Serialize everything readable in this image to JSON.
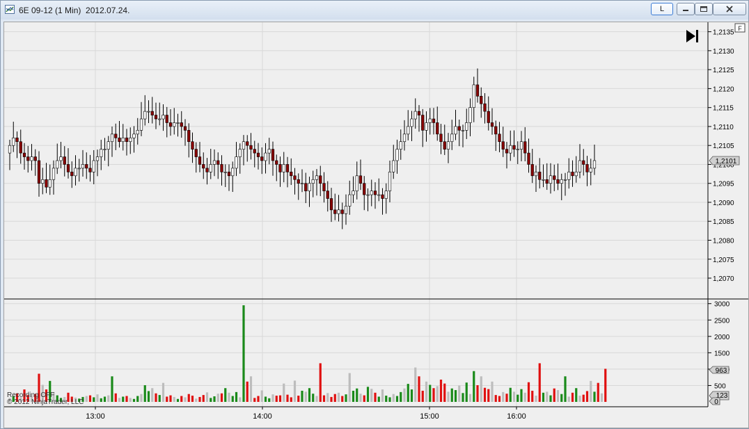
{
  "window": {
    "title": "6E 09-12 (1 Min)  2012.07.24.",
    "btn_l": "L",
    "btn_min": "",
    "btn_max": "",
    "btn_close": "",
    "corner_label": "F",
    "colors": {
      "bg": "#efefef",
      "grid": "#d8d8d8",
      "up": "#ffffff",
      "down": "#8b0000",
      "vol_up": "#1a8a1a",
      "vol_down": "#e01010",
      "vol_flat": "#bdbdbd"
    }
  },
  "status": {
    "recording": "Recording OFF",
    "copyright": "© 2012 NinjaTrader, LLC"
  },
  "chart_data": [
    {
      "type": "candlestick",
      "title": "6E 09-12 (1 Min)",
      "x_tick_labels": [
        "13:00",
        "14:00",
        "15:00",
        "16:00"
      ],
      "y_tick_labels": [
        "1,2135",
        "1,2130",
        "1,2125",
        "1,2120",
        "1,2115",
        "1,2110",
        "1,2105",
        "1,2100",
        "1,2095",
        "1,2090",
        "1,2085",
        "1,2080",
        "1,2075",
        "1,2070"
      ],
      "ylim": [
        1.20645,
        1.21375
      ],
      "last_price_label": "1,2101",
      "grid": true,
      "closes": [
        1.2105,
        1.2107,
        1.2106,
        1.2103,
        1.2102,
        1.2101,
        1.2102,
        1.2101,
        1.2095,
        1.2096,
        1.2094,
        1.2096,
        1.2099,
        1.2101,
        1.2102,
        1.21,
        1.2098,
        1.2097,
        1.2099,
        1.2099,
        1.21,
        1.2099,
        1.2098,
        1.2101,
        1.2102,
        1.2104,
        1.2104,
        1.2106,
        1.2108,
        1.2107,
        1.2106,
        1.2107,
        1.2106,
        1.2107,
        1.2108,
        1.2109,
        1.2112,
        1.2114,
        1.2114,
        1.2113,
        1.2112,
        1.2112,
        1.2113,
        1.2111,
        1.211,
        1.2111,
        1.2111,
        1.211,
        1.2109,
        1.2106,
        1.2104,
        1.2102,
        1.21,
        1.2099,
        1.2098,
        1.21,
        1.2101,
        1.21,
        1.2098,
        1.2098,
        1.2097,
        1.2099,
        1.2102,
        1.2104,
        1.2106,
        1.2105,
        1.2104,
        1.2103,
        1.2102,
        1.2101,
        1.2103,
        1.2104,
        1.2101,
        1.21,
        1.2098,
        1.21,
        1.2098,
        1.2097,
        1.2096,
        1.2095,
        1.2095,
        1.2093,
        1.2095,
        1.2096,
        1.2097,
        1.2095,
        1.2093,
        1.2091,
        1.2088,
        1.2087,
        1.2088,
        1.2087,
        1.2089,
        1.2092,
        1.2093,
        1.2097,
        1.2095,
        1.2092,
        1.2092,
        1.2093,
        1.2092,
        1.2092,
        1.2091,
        1.2093,
        1.2098,
        1.2101,
        1.2104,
        1.2106,
        1.2108,
        1.211,
        1.2112,
        1.2114,
        1.2113,
        1.2109,
        1.2111,
        1.2112,
        1.2111,
        1.2108,
        1.2106,
        1.2104,
        1.2106,
        1.2108,
        1.211,
        1.2109,
        1.2109,
        1.2111,
        1.2115,
        1.2121,
        1.2118,
        1.2116,
        1.2114,
        1.2111,
        1.211,
        1.2108,
        1.2106,
        1.2104,
        1.2103,
        1.2105,
        1.2104,
        1.2104,
        1.2106,
        1.2103,
        1.21,
        1.2097,
        1.2098,
        1.2096,
        1.2096,
        1.2095,
        1.2097,
        1.2096,
        1.2095,
        1.2096,
        1.2096,
        1.2098,
        1.2097,
        1.2098,
        1.2101,
        1.21,
        1.2098,
        1.2099,
        1.2101
      ]
    },
    {
      "type": "bar",
      "title": "Volume",
      "y_tick_labels": [
        "3000",
        "2500",
        "2000",
        "1500",
        "1000",
        "500"
      ],
      "ylim": [
        0,
        3100
      ],
      "last_volume_label": "963",
      "last_down_label": "123",
      "zero_label": "0",
      "volumes": [
        120,
        180,
        260,
        140,
        380,
        210,
        160,
        240,
        860,
        520,
        380,
        640,
        300,
        200,
        120,
        150,
        280,
        160,
        130,
        100,
        150,
        180,
        200,
        140,
        230,
        110,
        160,
        200,
        780,
        260,
        120,
        160,
        180,
        120,
        90,
        180,
        240,
        510,
        330,
        420,
        260,
        210,
        580,
        160,
        200,
        150,
        90,
        180,
        140,
        240,
        190,
        100,
        150,
        210,
        290,
        120,
        170,
        250,
        260,
        420,
        280,
        180,
        300,
        140,
        2950,
        620,
        780,
        120,
        180,
        350,
        160,
        110,
        230,
        190,
        200,
        560,
        220,
        140,
        650,
        190,
        340,
        310,
        420,
        250,
        180,
        1180,
        200,
        270,
        150,
        240,
        280,
        180,
        230,
        880,
        340,
        410,
        250,
        200,
        460,
        400,
        280,
        160,
        380,
        190,
        140,
        240,
        180,
        300,
        410,
        550,
        380,
        1050,
        780,
        340,
        620,
        520,
        420,
        480,
        680,
        560,
        310,
        410,
        360,
        500,
        270,
        590,
        240,
        940,
        510,
        780,
        430,
        390,
        620,
        210,
        180,
        300,
        250,
        430,
        310,
        220,
        390,
        280,
        600,
        340,
        190,
        1180,
        280,
        310,
        200,
        410,
        360,
        240,
        780,
        160,
        280,
        420,
        190,
        220,
        330,
        640,
        310,
        580,
        260,
        1010
      ]
    }
  ]
}
